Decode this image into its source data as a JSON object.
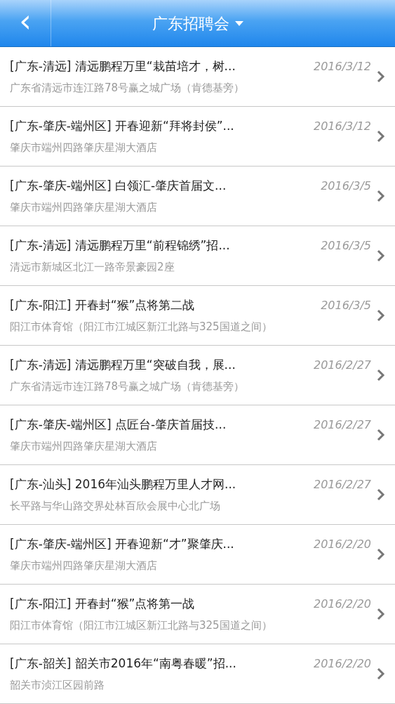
{
  "header": {
    "back": "‹",
    "title": "广东招聘会",
    "dropdown": true
  },
  "events": [
    {
      "title": "[广东-清远] 清远鹏程万里“栽苗培才，树...",
      "date": "2016/3/12",
      "address": "广东省清远市连江路78号赢之城广场（肯德基旁）"
    },
    {
      "title": "[广东-肇庆-端州区] 开春迎新“拜将封侯”...",
      "date": "2016/3/12",
      "address": "肇庆市端州四路肇庆星湖大酒店"
    },
    {
      "title": "[广东-肇庆-端州区] 白领汇-肇庆首届文...",
      "date": "2016/3/5",
      "address": "肇庆市端州四路肇庆星湖大酒店"
    },
    {
      "title": "[广东-清远] 清远鹏程万里“前程锦绣”招...",
      "date": "2016/3/5",
      "address": "清远市新城区北江一路帝景豪园2座"
    },
    {
      "title": "[广东-阳江] 开春封“猴”点将第二战",
      "date": "2016/3/5",
      "address": "阳江市体育馆（阳江市江城区新江北路与325国道之间）"
    },
    {
      "title": "[广东-清远] 清远鹏程万里“突破自我，展...",
      "date": "2016/2/27",
      "address": "广东省清远市连江路78号赢之城广场（肯德基旁）"
    },
    {
      "title": "[广东-肇庆-端州区] 点匠台-肇庆首届技...",
      "date": "2016/2/27",
      "address": "肇庆市端州四路肇庆星湖大酒店"
    },
    {
      "title": "[广东-汕头] 2016年汕头鹏程万里人才网...",
      "date": "2016/2/27",
      "address": "长平路与华山路交界处林百欣会展中心北广场"
    },
    {
      "title": "[广东-肇庆-端州区] 开春迎新“才”聚肇庆...",
      "date": "2016/2/20",
      "address": "肇庆市端州四路肇庆星湖大酒店"
    },
    {
      "title": "[广东-阳江] 开春封“猴”点将第一战",
      "date": "2016/2/20",
      "address": "阳江市体育馆（阳江市江城区新江北路与325国道之间）"
    },
    {
      "title": "[广东-韶关] 韶关市2016年“南粤春暖”招...",
      "date": "2016/2/20",
      "address": "韶关市浈江区园前路"
    }
  ]
}
